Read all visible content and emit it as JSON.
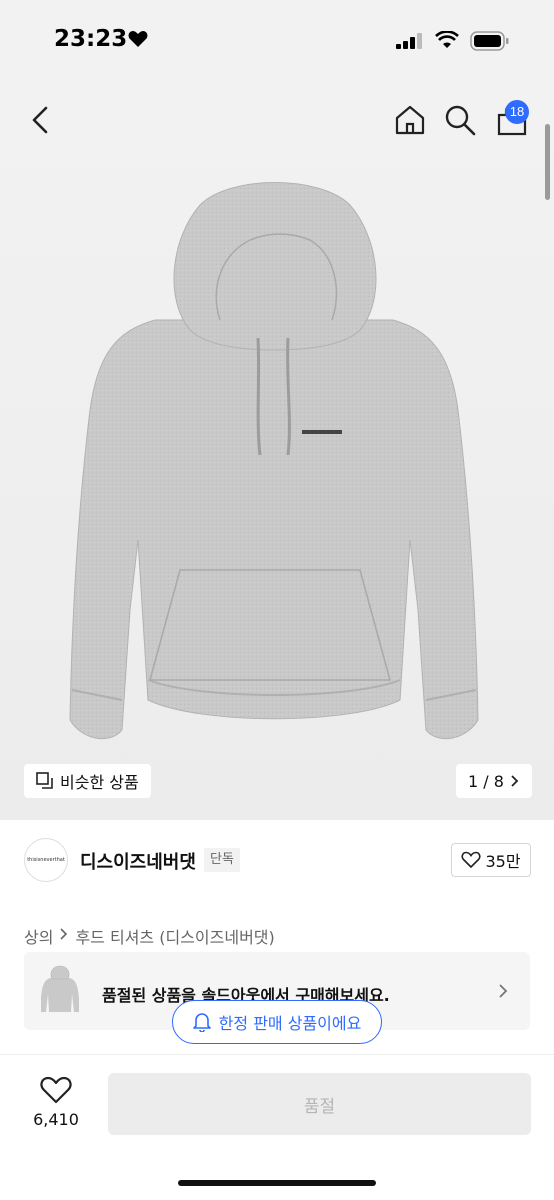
{
  "status_bar": {
    "time": "23:23"
  },
  "header": {
    "cart_count": "18"
  },
  "gallery": {
    "similar_label": "비슷한 상품",
    "page_indicator": "1 / 8"
  },
  "brand": {
    "logo_text": "thisisneverthat",
    "name": "디스이즈네버댓",
    "badge": "단독",
    "likes": "35만"
  },
  "breadcrumb": [
    "상의",
    "후드 티셔츠 (디스이즈네버댓)"
  ],
  "banner": {
    "text": "품절된 상품을 솔드아웃에서 구매해보세요."
  },
  "limited_pill": {
    "text": "한정 판매 상품이에요"
  },
  "bottom_bar": {
    "favorite_count": "6,410",
    "soldout_label": "품절"
  },
  "colors": {
    "accent": "#2f6bff",
    "hoodie_gray": "#c8c8c8",
    "disabled_bg": "#ececec"
  }
}
